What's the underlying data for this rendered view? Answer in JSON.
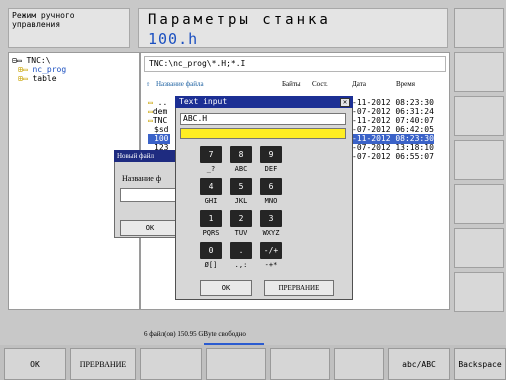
{
  "header": {
    "mode_line1": "Режим ручного",
    "mode_line2": "управления",
    "title": "Параметры станка",
    "file": "100.h"
  },
  "tree": {
    "drive": "TNC:\\",
    "folder1": "nc_prog",
    "folder2": "table"
  },
  "filepanel": {
    "path": "TNC:\\nc_prog\\*.H;*.I",
    "col_name": "Название файла",
    "col_bytes": "Байты",
    "col_status": "Сост.",
    "col_date": "Дата",
    "col_time": "Время",
    "files": [
      "..",
      "dem",
      "TNC",
      "$sd",
      "100",
      "123"
    ],
    "datetimes": [
      "-11-2012 08:23:30",
      "-07-2012 06:31:24",
      "-11-2012 07:40:07",
      "-07-2012 06:42:05",
      "-11-2012 08:23:30",
      "-07-2012 13:18:10",
      "-07-2012 06:55:07"
    ],
    "status": "6   файл(ов) 150.95 GByte свободно"
  },
  "newfile_dialog": {
    "title": "Новый файл",
    "label": "Название ф",
    "ok": "OK"
  },
  "text_input": {
    "title": "Text input",
    "value": "ABC.H",
    "keys": [
      "7",
      "8",
      "9",
      "4",
      "5",
      "6",
      "1",
      "2",
      "3",
      "0",
      ".",
      "-/+"
    ],
    "labels": [
      "_?",
      "ABC",
      "DEF",
      "GHI",
      "JKL",
      "MNO",
      "PQRS",
      "TUV",
      "WXYZ",
      "Ø[]",
      ".,:",
      "-+*"
    ],
    "ok": "OK",
    "cancel": "ПРЕРВАНИЕ"
  },
  "bottom": {
    "ok": "OK",
    "cancel": "ПРЕРВАНИЕ",
    "case": "abc/ABC",
    "backspace": "Backspace"
  },
  "colors": {
    "title_blue": "#1a4fc0",
    "dialog_titlebar": "#1c2f94",
    "input_yellow": "#ffee22",
    "key_dark": "#252525"
  }
}
